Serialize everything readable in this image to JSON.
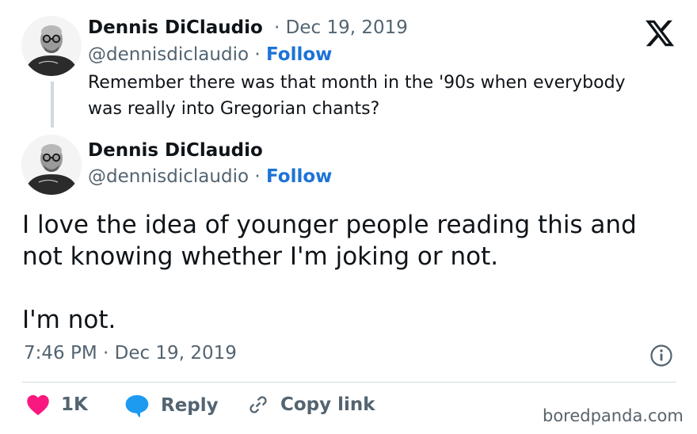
{
  "quoted_tweet": {
    "author_name": "Dennis DiClaudio",
    "separator": "·",
    "date": "Dec 19, 2019",
    "handle": "@dennisdiclaudio",
    "follow_label": "Follow",
    "text": "Remember there was that month in the '90s when everybody was really into Gregorian chants?"
  },
  "main_tweet": {
    "author_name": "Dennis DiClaudio",
    "handle": "@dennisdiclaudio",
    "separator": "·",
    "follow_label": "Follow",
    "text_line1": "I love the idea of younger people reading this and not knowing whether I'm joking or not.",
    "text_line2": "I'm not.",
    "timestamp": "7:46 PM · Dec 19, 2019"
  },
  "actions": {
    "like_count": "1K",
    "reply_label": "Reply",
    "copy_link_label": "Copy link"
  },
  "icons": {
    "brand": "x-logo-icon",
    "info": "info-icon",
    "like": "heart-icon",
    "reply": "speech-bubble-icon",
    "copy": "link-icon"
  },
  "colors": {
    "accent": "#1d73d6",
    "like": "#f91880",
    "muted_text": "#536471"
  },
  "watermark": "boredpanda.com"
}
